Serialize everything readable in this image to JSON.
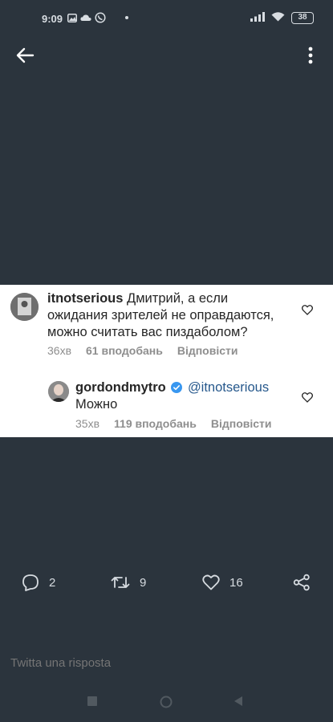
{
  "status_bar": {
    "time": "9:09",
    "battery": "38"
  },
  "comments": [
    {
      "username": "itnotserious",
      "text": "Дмитрий, а если ожидания зрителей не оправдаются, можно считать вас пиздаболом?",
      "age": "36хв",
      "likes": "61 вподобань",
      "reply_label": "Відповісти"
    },
    {
      "username": "gordondmytro",
      "verified": true,
      "mention": "@itnotserious",
      "text": "Можно",
      "age": "35хв",
      "likes": "119 вподобань",
      "reply_label": "Відповісти"
    }
  ],
  "actions": {
    "replies": "2",
    "retweets": "9",
    "likes": "16"
  },
  "reply_input": {
    "placeholder": "Twitta una risposta"
  },
  "colors": {
    "background": "#2b343d",
    "card": "#ffffff",
    "verified": "#3897f0",
    "mention": "#26588c"
  }
}
